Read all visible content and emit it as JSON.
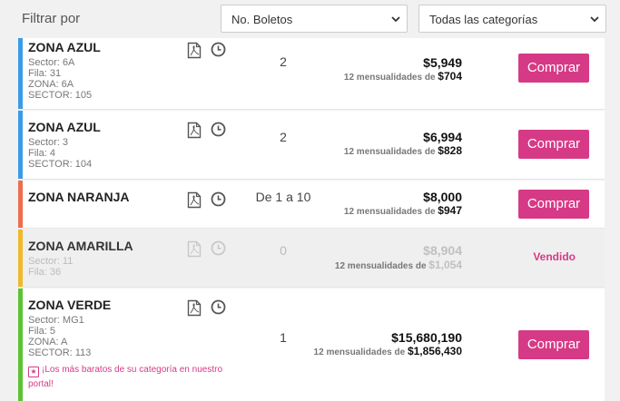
{
  "filters": {
    "label": "Filtrar por",
    "tickets_select": "No. Boletos",
    "category_select": "Todas las categorías"
  },
  "rows": [
    {
      "zone": "ZONA AZUL",
      "details": [
        "Sector: 6A",
        "Fila: 31",
        "ZONA: 6A",
        "SECTOR: 105"
      ],
      "qty": "2",
      "price": "$5,949",
      "monthly_label": "12 mensualidades de",
      "monthly_amount": "$704",
      "action": "Comprar",
      "color": "#3a9be6"
    },
    {
      "zone": "ZONA AZUL",
      "details": [
        "Sector: 3",
        "Fila: 4",
        "SECTOR: 104"
      ],
      "qty": "2",
      "price": "$6,994",
      "monthly_label": "12 mensualidades de",
      "monthly_amount": "$828",
      "action": "Comprar",
      "color": "#3a9be6"
    },
    {
      "zone": "ZONA NARANJA",
      "details": [],
      "qty": "De 1 a 10",
      "price": "$8,000",
      "monthly_label": "12 mensualidades de",
      "monthly_amount": "$947",
      "action": "Comprar",
      "color": "#ee6d4f"
    },
    {
      "zone": "ZONA AMARILLA",
      "details": [
        "Sector: 11",
        "Fila: 36"
      ],
      "qty": "0",
      "price": "$8,904",
      "monthly_label": "12 mensualidades de",
      "monthly_amount": "$1,054",
      "action": "Vendido",
      "color": "#f0b92b"
    },
    {
      "zone": "ZONA VERDE",
      "details": [
        "Sector: MG1",
        "Fila: 5",
        "ZONA: A",
        "SECTOR: 113"
      ],
      "qty": "1",
      "price": "$15,680,190",
      "monthly_label": "12 mensualidades de",
      "monthly_amount": "$1,856,430",
      "action": "Comprar",
      "color": "#5cc233",
      "promo": "¡Los más baratos de su categoría en nuestro portal!"
    }
  ],
  "icons": {
    "document": "document-icon",
    "clock": "clock-icon",
    "chevron": "chevron-down-icon",
    "promo": "star-badge-icon"
  },
  "colors": {
    "accent": "#d63a86"
  }
}
